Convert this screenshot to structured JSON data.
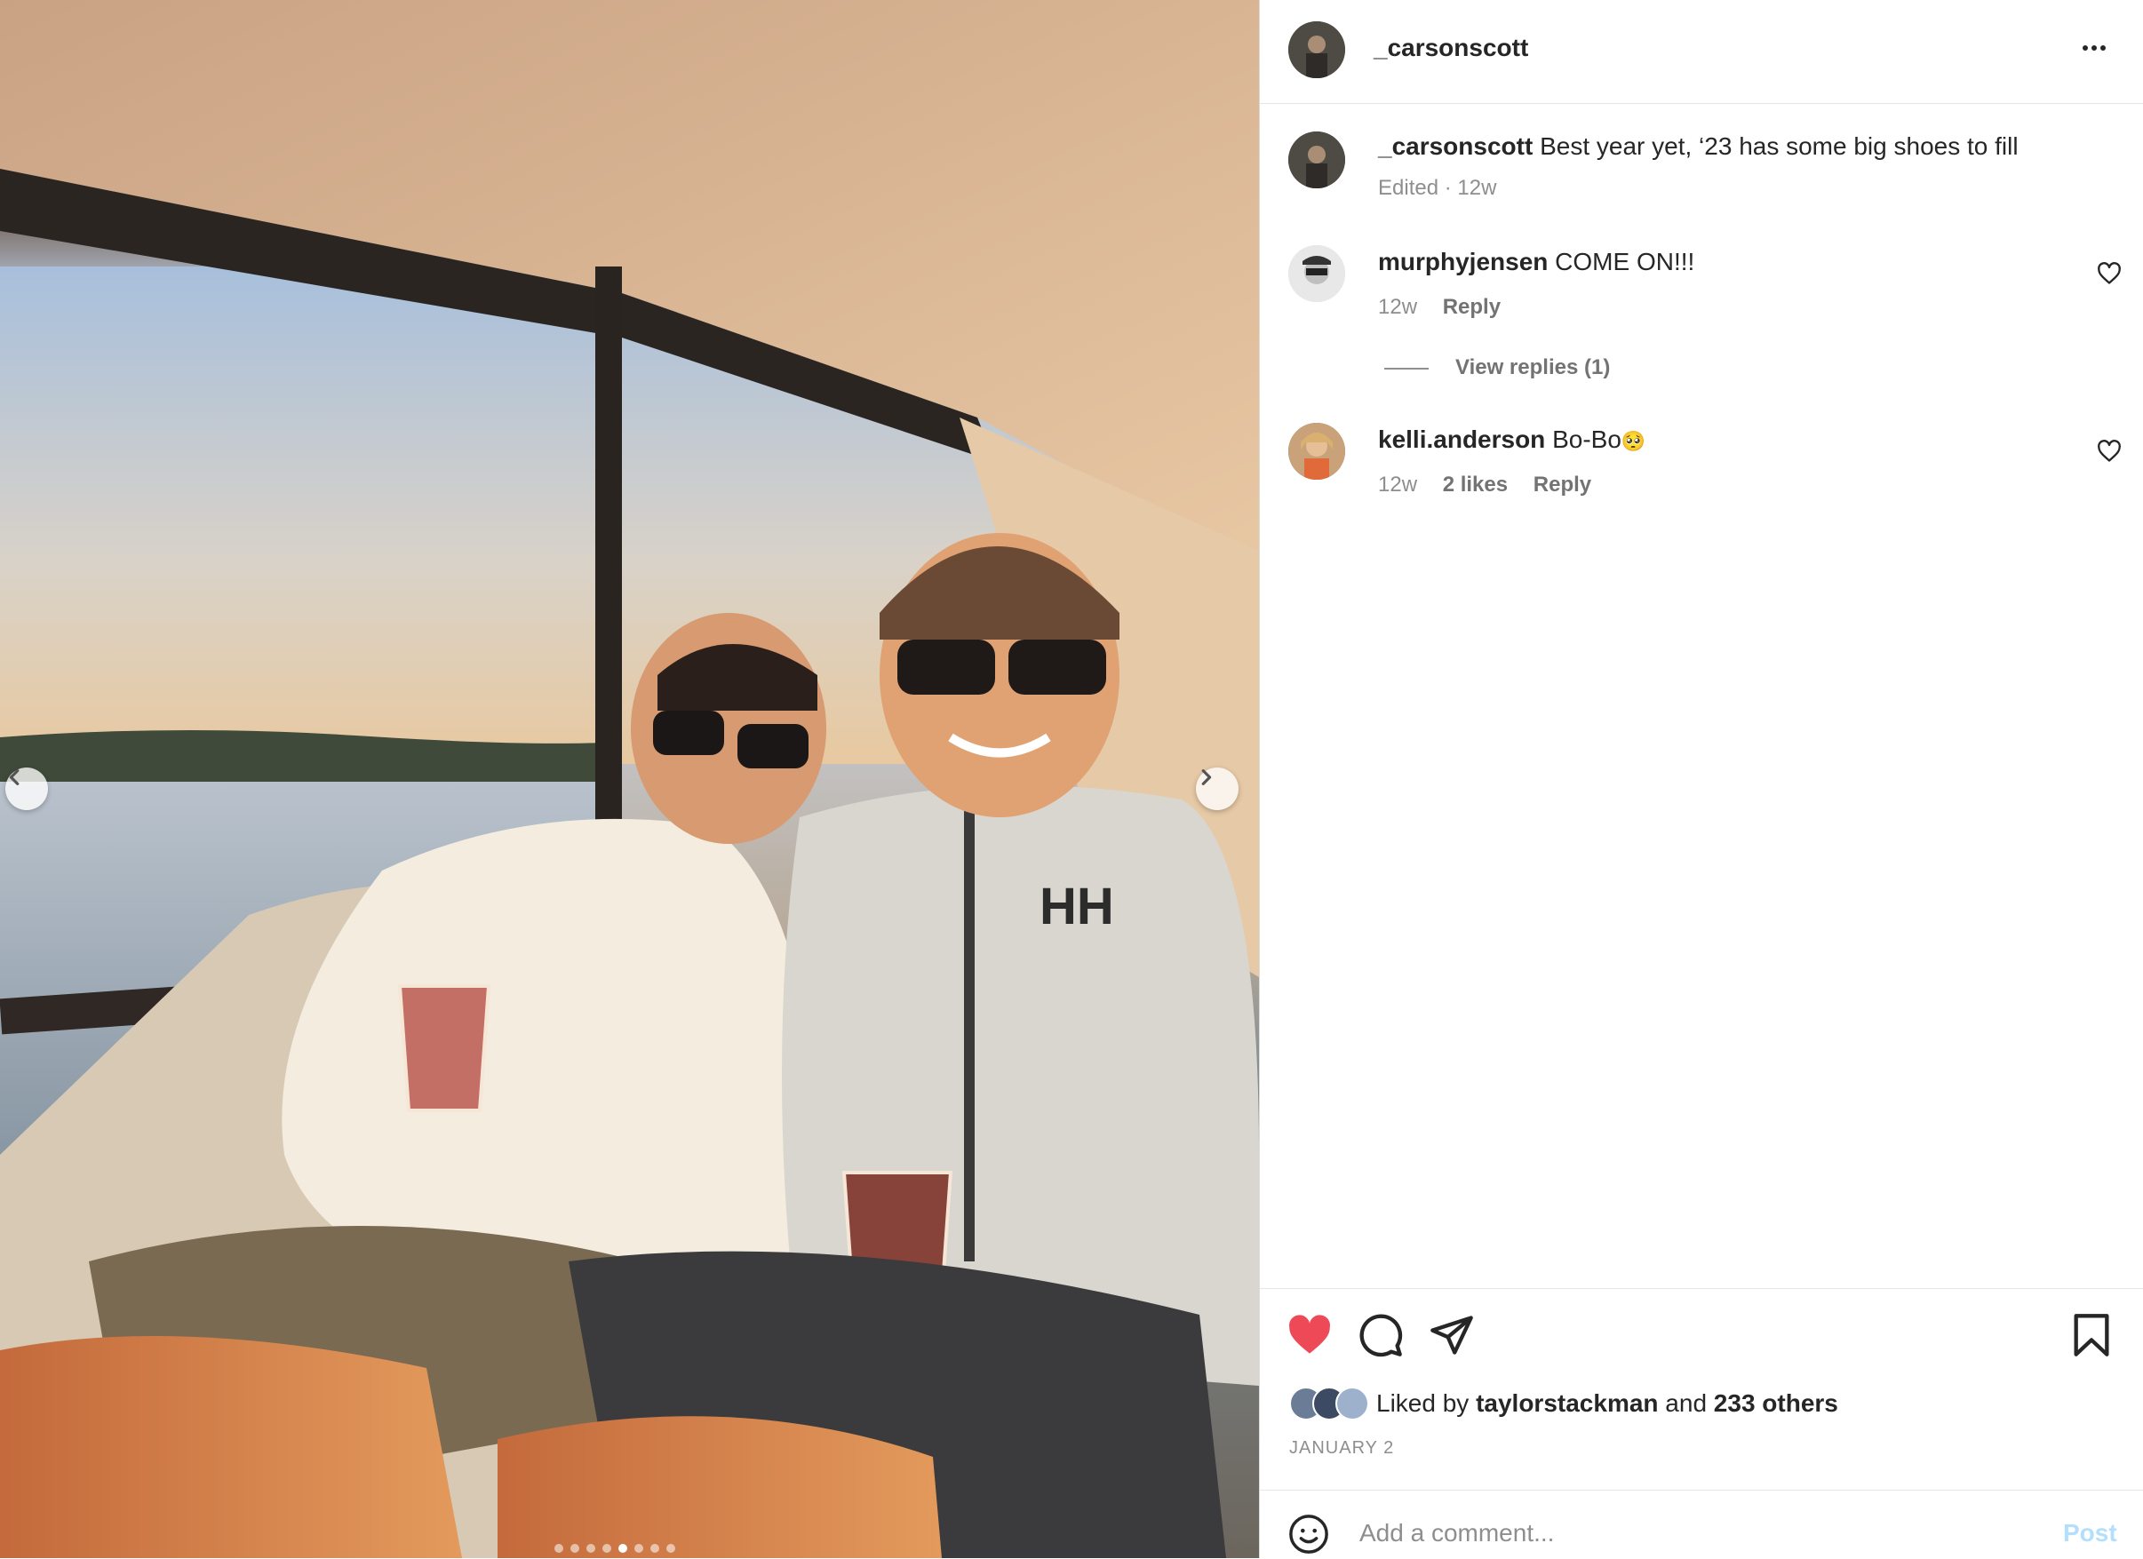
{
  "post": {
    "author": "_carsonscott",
    "caption": "Best year yet, ‘23 has some big shoes to fill",
    "caption_meta": "Edited · 12w",
    "carousel_count": 8,
    "carousel_active": 5
  },
  "comments": [
    {
      "username": "murphyjensen",
      "text": "COME ON!!!",
      "age": "12w",
      "likes": "",
      "reply_label": "Reply",
      "view_replies": "View replies (1)"
    },
    {
      "username": "kelli.anderson",
      "text": "Bo-Bo",
      "emoji": "🥺",
      "age": "12w",
      "likes": "2 likes",
      "reply_label": "Reply"
    }
  ],
  "likes": {
    "prefix": "Liked by",
    "user": "taylorstackman",
    "joiner": "and",
    "others": "233 others"
  },
  "date": "JANUARY 2",
  "comment_box": {
    "placeholder": "Add a comment...",
    "post_label": "Post"
  },
  "colors": {
    "like_red": "#ed4956",
    "post_disabled": "#b2dffc",
    "text": "#262626",
    "secondary": "#8e8e8e"
  },
  "icons": [
    "prev-arrow-icon",
    "next-arrow-icon",
    "more-icon",
    "heart-icon",
    "comment-icon",
    "share-icon",
    "bookmark-icon",
    "emoji-icon"
  ]
}
